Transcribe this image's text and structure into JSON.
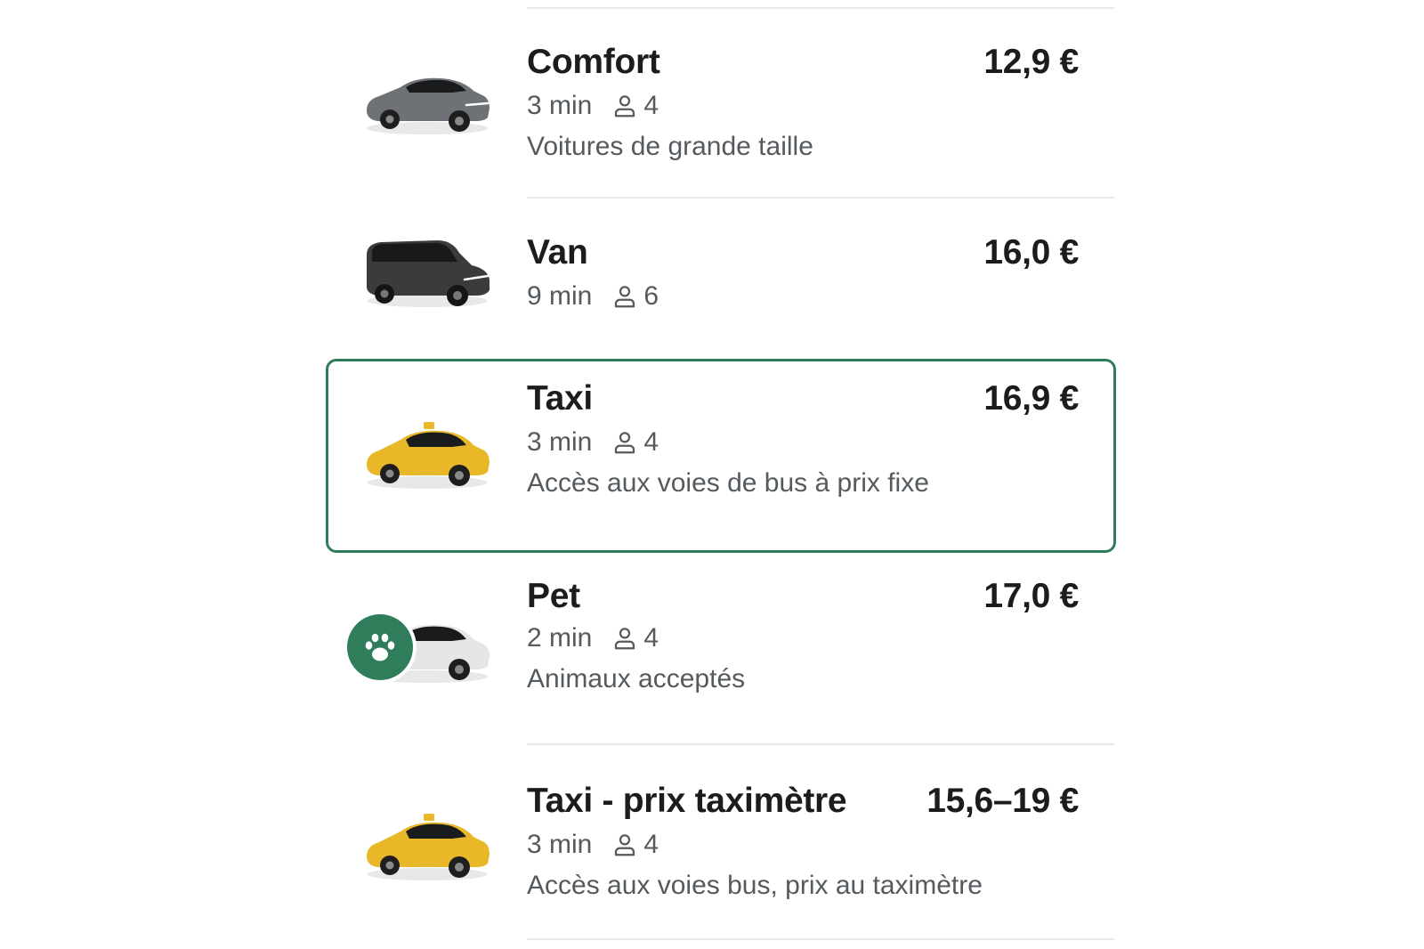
{
  "rides": [
    {
      "name": "Comfort",
      "price": "12,9 €",
      "eta": "3 min",
      "seats": "4",
      "description": "Voitures de grande taille",
      "car_color": "#6e7175",
      "icon": "car-icon",
      "selected": false
    },
    {
      "name": "Van",
      "price": "16,0 €",
      "eta": "9 min",
      "seats": "6",
      "description": "",
      "car_color": "#3a3b3d",
      "icon": "van-icon",
      "selected": false
    },
    {
      "name": "Taxi",
      "price": "16,9 €",
      "eta": "3 min",
      "seats": "4",
      "description": "Accès aux voies de bus à prix fixe",
      "car_color": "#e8b829",
      "icon": "taxi-icon",
      "selected": true
    },
    {
      "name": "Pet",
      "price": "17,0 €",
      "eta": "2 min",
      "seats": "4",
      "description": "Animaux acceptés",
      "car_color": "#e4e6e8",
      "icon": "paw-icon",
      "selected": false
    },
    {
      "name": "Taxi - prix taximètre",
      "price": "15,6–19 €",
      "eta": "3 min",
      "seats": "4",
      "description": "Accès aux voies bus, prix au taximètre",
      "car_color": "#e8b829",
      "icon": "taxi-icon",
      "selected": false
    }
  ],
  "colors": {
    "accent": "#2f7d5b",
    "divider": "#e9e9e9",
    "text_primary": "#1c1c1c",
    "text_secondary": "#555a5e"
  }
}
